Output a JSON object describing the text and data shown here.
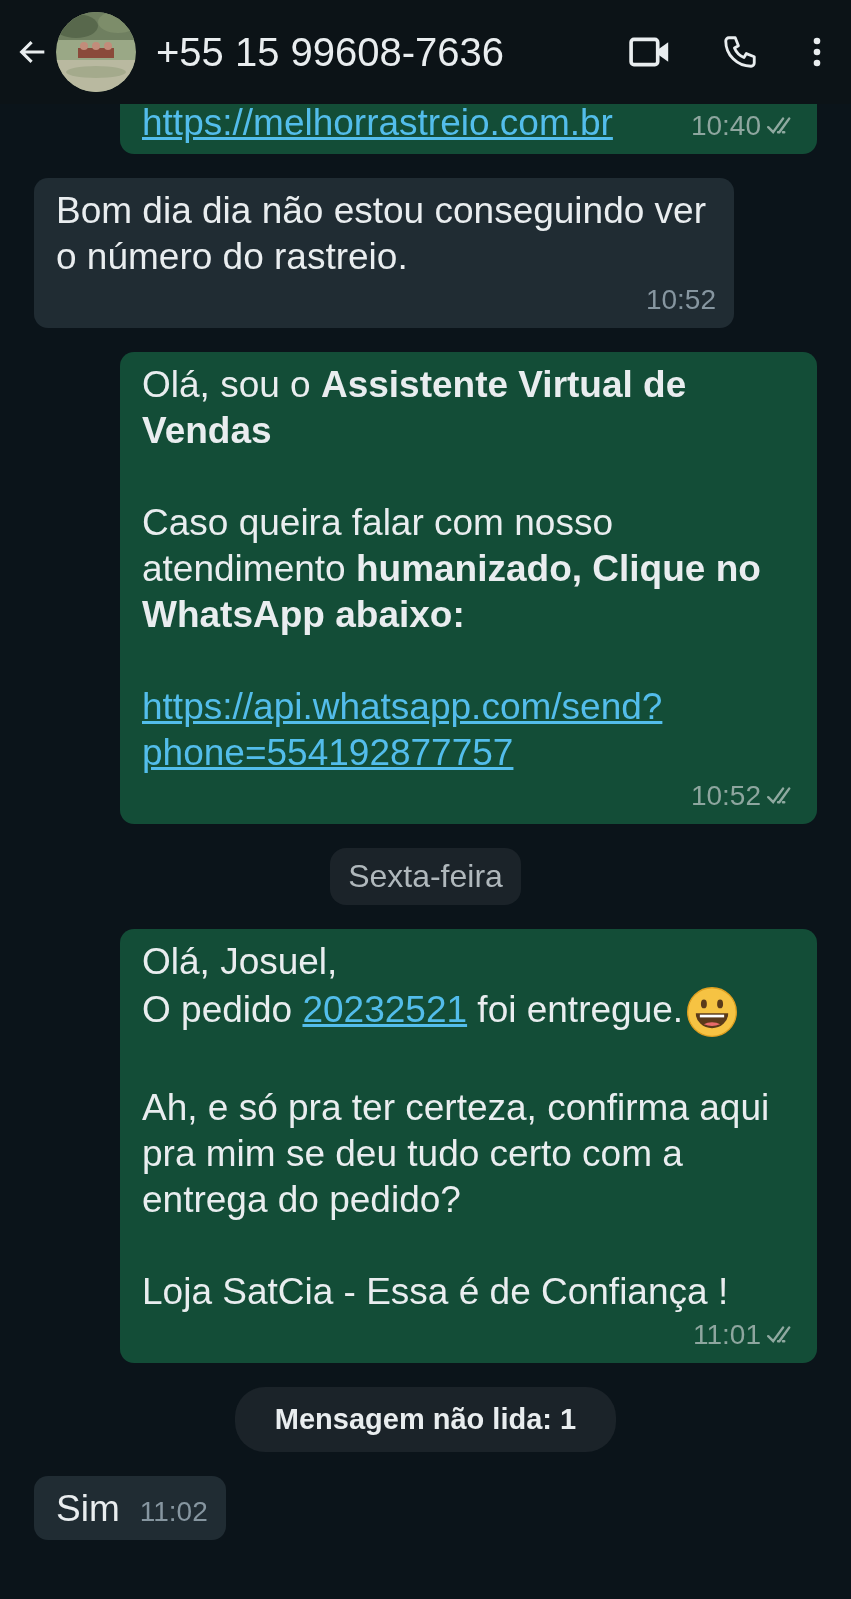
{
  "header": {
    "title": "+55 15 99608-7636"
  },
  "messages": [
    {
      "kind": "message",
      "outgoing": true,
      "paragraphs": [
        [
          [
            {
              "kind": "link",
              "text": "https://melhorrastreio.com.br"
            }
          ]
        ]
      ],
      "time": "10:40",
      "read": false
    },
    {
      "kind": "message",
      "outgoing": false,
      "paragraphs": [
        [
          [
            {
              "kind": "text",
              "text": "Bom dia dia não estou conseguindo ver o número do rastreio."
            }
          ]
        ]
      ],
      "time": "10:52"
    },
    {
      "kind": "message",
      "outgoing": true,
      "paragraphs": [
        [
          [
            {
              "kind": "text",
              "text": "Olá, sou o **Assistente Virtual de Vendas**"
            }
          ]
        ],
        [
          [
            {
              "kind": "text",
              "text": "Caso queira falar com nosso atendimento **humanizado, Clique no WhatsApp abaixo:**"
            }
          ]
        ],
        [
          [
            {
              "kind": "link",
              "text": "https://api.whatsapp.com/send?phone=554192877757"
            }
          ]
        ]
      ],
      "time": "10:52",
      "read": false
    },
    {
      "kind": "date",
      "text": "Sexta-feira"
    },
    {
      "kind": "message",
      "outgoing": true,
      "paragraphs": [
        [
          [
            {
              "kind": "text",
              "text": "Olá, Josuel,"
            }
          ],
          [
            {
              "kind": "text",
              "text": "O pedido "
            },
            {
              "kind": "link",
              "text": "20232521"
            },
            {
              "kind": "text",
              "text": " foi entregue."
            },
            {
              "kind": "emoji_smile"
            }
          ]
        ],
        [
          [
            {
              "kind": "text",
              "text": "Ah, e só pra ter certeza, confirma aqui pra mim se deu tudo certo com a entrega do pedido?"
            }
          ]
        ],
        [
          [
            {
              "kind": "text",
              "text": "Loja SatCia - Essa é de Confiança !"
            }
          ]
        ]
      ],
      "time": "11:01",
      "read": false
    },
    {
      "kind": "unread",
      "text": "Mensagem não lida: 1"
    },
    {
      "kind": "message",
      "outgoing": false,
      "paragraphs": [
        [
          [
            {
              "kind": "text",
              "text": "Sim"
            }
          ]
        ]
      ],
      "time": "11:02"
    }
  ]
}
